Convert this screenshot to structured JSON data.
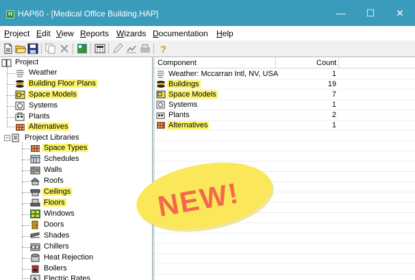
{
  "window": {
    "title": "HAP60 - [Medical Office Building.HAP]",
    "app_icon_text": "H",
    "minimize_glyph": "—",
    "maximize_glyph": "☐",
    "close_glyph": "✕"
  },
  "menu": [
    {
      "acc": "P",
      "rest": "roject"
    },
    {
      "acc": "E",
      "rest": "dit"
    },
    {
      "acc": "V",
      "rest": "iew"
    },
    {
      "acc": "R",
      "rest": "eports"
    },
    {
      "acc": "W",
      "rest": "izards"
    },
    {
      "acc": "D",
      "rest": "ocumentation"
    },
    {
      "acc": "H",
      "rest": "elp"
    }
  ],
  "toolbar": [
    "new-icon",
    "open-icon",
    "save-icon",
    "copy-icon",
    "delete-icon",
    "wizard-icon",
    "calculator-icon",
    "edit-icon",
    "chart-icon",
    "reports-icon",
    "help-icon"
  ],
  "tree": {
    "root": "Project",
    "items": [
      {
        "label": "Weather",
        "highlight": false
      },
      {
        "label": "Building Floor Plans",
        "highlight": true
      },
      {
        "label": "Space Models",
        "highlight": true
      },
      {
        "label": "Systems",
        "highlight": false
      },
      {
        "label": "Plants",
        "highlight": false
      },
      {
        "label": "Alternatives",
        "highlight": true
      }
    ],
    "libraries": {
      "label": "Project Libraries",
      "expander": "−",
      "items": [
        {
          "label": "Space Types",
          "highlight": true
        },
        {
          "label": "Schedules",
          "highlight": false
        },
        {
          "label": "Walls",
          "highlight": false
        },
        {
          "label": "Roofs",
          "highlight": false
        },
        {
          "label": "Ceilings",
          "highlight": true
        },
        {
          "label": "Floors",
          "highlight": true
        },
        {
          "label": "Windows",
          "highlight": false
        },
        {
          "label": "Doors",
          "highlight": false
        },
        {
          "label": "Shades",
          "highlight": false
        },
        {
          "label": "Chillers",
          "highlight": false
        },
        {
          "label": "Heat Rejection",
          "highlight": false
        },
        {
          "label": "Boilers",
          "highlight": false
        },
        {
          "label": "Electric Rates",
          "highlight": false
        }
      ]
    }
  },
  "list": {
    "columns": {
      "component": "Component",
      "count": "Count"
    },
    "rows": [
      {
        "name": "Weather: Mccarran Intl, NV, USA",
        "count": "1",
        "highlight": false
      },
      {
        "name": "Buildings",
        "count": "19",
        "highlight": true
      },
      {
        "name": "Space Models",
        "count": "7",
        "highlight": true
      },
      {
        "name": "Systems",
        "count": "1",
        "highlight": false
      },
      {
        "name": "Plants",
        "count": "2",
        "highlight": false
      },
      {
        "name": "Alternatives",
        "count": "1",
        "highlight": true
      }
    ]
  },
  "badge": {
    "text": "NEW!"
  },
  "colors": {
    "titlebar": "#3a9cba",
    "highlight": "#fbf46a",
    "badge_fill": "#fbe75a",
    "badge_text": "#f26a4b"
  }
}
